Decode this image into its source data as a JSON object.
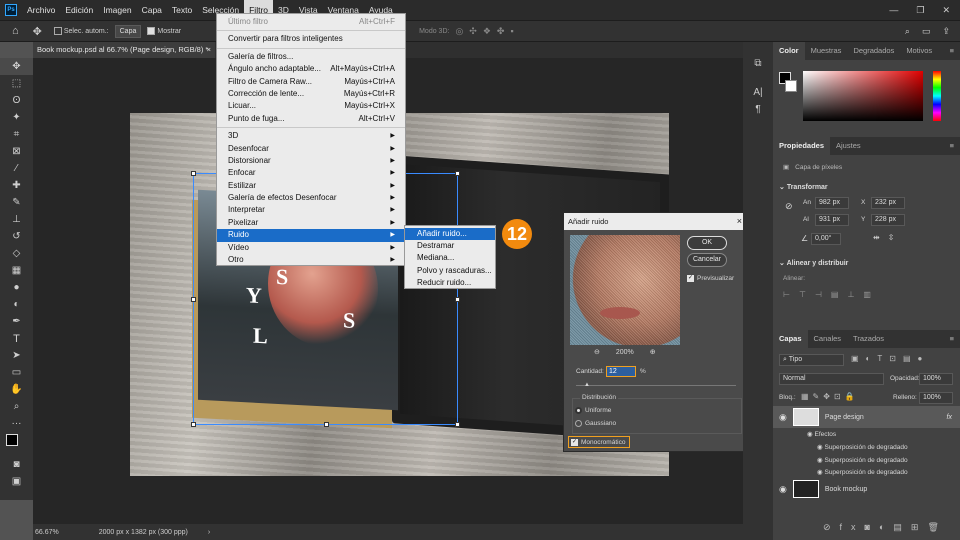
{
  "menubar": {
    "items": [
      "Archivo",
      "Edición",
      "Imagen",
      "Capa",
      "Texto",
      "Selección",
      "Filtro",
      "3D",
      "Vista",
      "Ventana",
      "Ayuda"
    ],
    "active": "Filtro"
  },
  "options": {
    "autosel": "Selec. autom.:",
    "layer": "Capa",
    "show": "Mostrar",
    "mode3d": "Modo 3D:"
  },
  "doc": {
    "tab": "Book mockup.psd al 66.7% (Page design, RGB/8) *",
    "zoom": "66.67%",
    "size": "2000 px x 1382 px (300 ppp)"
  },
  "filter_menu": {
    "top": [
      {
        "label": "Último filtro",
        "shortcut": "Alt+Ctrl+F",
        "disabled": true
      }
    ],
    "smart": "Convertir para filtros inteligentes",
    "group1": [
      {
        "label": "Galería de filtros...",
        "shortcut": ""
      },
      {
        "label": "Ángulo ancho adaptable...",
        "shortcut": "Alt+Mayús+Ctrl+A"
      },
      {
        "label": "Filtro de Camera Raw...",
        "shortcut": "Mayús+Ctrl+A"
      },
      {
        "label": "Corrección de lente...",
        "shortcut": "Mayús+Ctrl+R"
      },
      {
        "label": "Licuar...",
        "shortcut": "Mayús+Ctrl+X"
      },
      {
        "label": "Punto de fuga...",
        "shortcut": "Alt+Ctrl+V"
      }
    ],
    "group2": [
      "3D",
      "Desenfocar",
      "Distorsionar",
      "Enfocar",
      "Estilizar",
      "Galería de efectos Desenfocar",
      "Interpretar",
      "Pixelizar",
      "Ruido",
      "Vídeo",
      "Otro"
    ],
    "highlighted": "Ruido"
  },
  "noise_submenu": {
    "items": [
      "Añadir ruido...",
      "Destramar",
      "Mediana...",
      "Polvo y rascaduras...",
      "Reducir ruido..."
    ],
    "highlighted": "Añadir ruido..."
  },
  "step_badge": "12",
  "dialog": {
    "title": "Añadir ruido",
    "ok": "OK",
    "cancel": "Cancelar",
    "preview": "Previsualizar",
    "zoom": "200%",
    "amount_label": "Cantidad:",
    "amount": "12",
    "unit": "%",
    "distribution": "Distribución",
    "uniform": "Uniforme",
    "gaussian": "Gaussiano",
    "mono": "Monocromático"
  },
  "book_letters": [
    "Y",
    "S",
    "L",
    "S"
  ],
  "panels": {
    "color_tabs": [
      "Color",
      "Muestras",
      "Degradados",
      "Motivos"
    ],
    "props_tabs": [
      "Propiedades",
      "Ajustes"
    ],
    "pixel_layer": "Capa de píxeles",
    "transform": "Transformar",
    "an": "An",
    "an_val": "982 px",
    "x": "X",
    "x_val": "232 px",
    "al": "Al",
    "al_val": "931 px",
    "y": "Y",
    "y_val": "228 px",
    "angle": "0,00°",
    "align": "Alinear y distribuir",
    "align_sub": "Alinear:",
    "layers_tabs": [
      "Capas",
      "Canales",
      "Trazados"
    ],
    "kind": "Tipo",
    "blend": "Normal",
    "opacity_label": "Opacidad:",
    "opacity": "100%",
    "lock": "Bloq.:",
    "fill_label": "Relleno:",
    "fill": "100%",
    "layers": [
      {
        "name": "Page design"
      },
      {
        "name": "Book mockup"
      }
    ],
    "effects": "Efectos",
    "effect_items": [
      "Superposición de degradado",
      "Superposición de degradado",
      "Superposición de degradado"
    ]
  },
  "colors": {
    "accent": "#1a6cc8",
    "badge": "#f28a0e",
    "highlight_box": "#f0a020"
  }
}
